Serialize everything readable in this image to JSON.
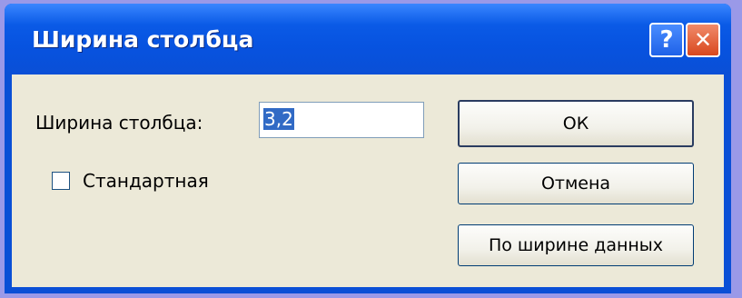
{
  "dialog": {
    "title": "Ширина столбца",
    "help_glyph": "?",
    "close_glyph": "✕"
  },
  "form": {
    "width_label": "Ширина столбца:",
    "width_value": "3,2",
    "standard_label": "Стандартная",
    "standard_checked": false
  },
  "buttons": {
    "ok": "ОК",
    "cancel": "Отмена",
    "fit": "По ширине данных"
  },
  "colors": {
    "titlebar": "#0a5ae6",
    "client_bg": "#ece9d8",
    "page_bg": "#9a99e8",
    "selection": "#316ac5"
  }
}
